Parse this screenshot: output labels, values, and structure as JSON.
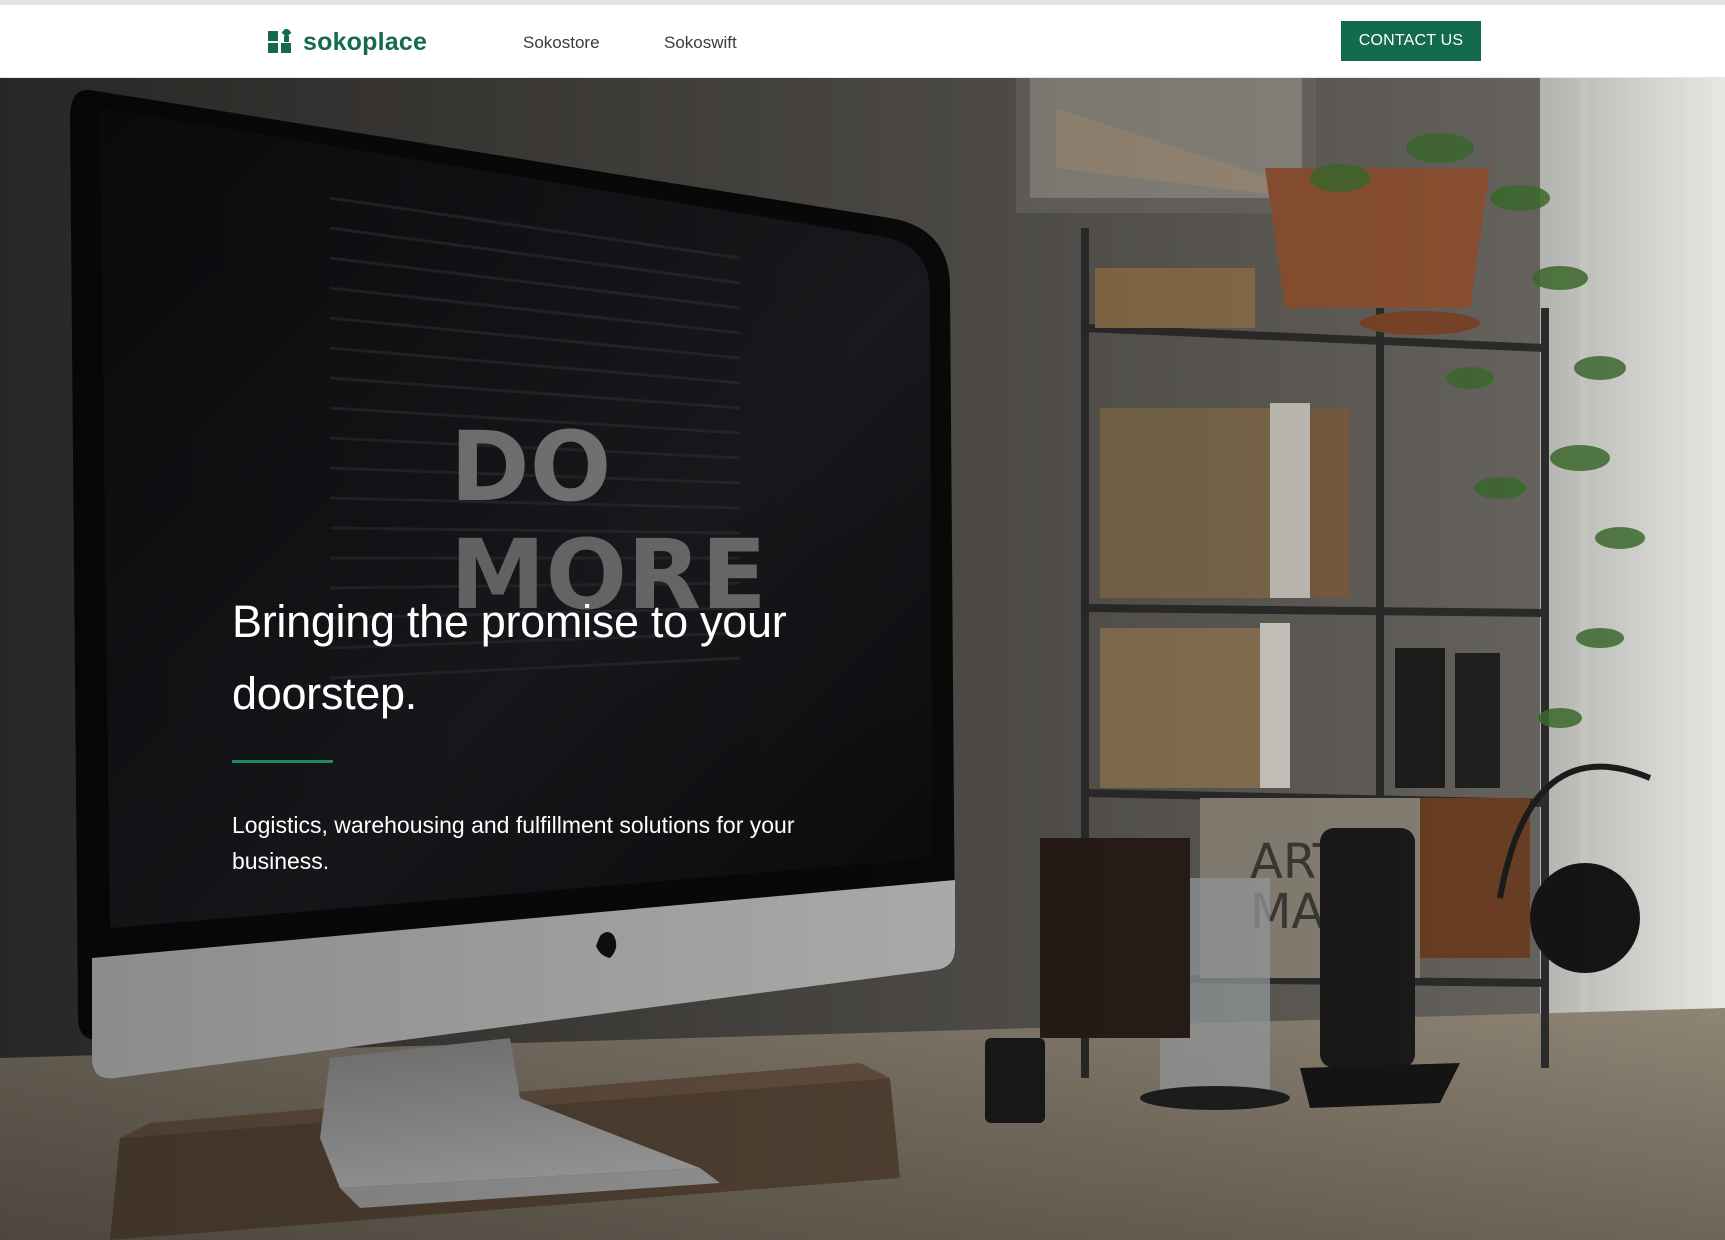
{
  "brand": {
    "name": "sokoplace",
    "color": "#136b4c"
  },
  "nav": {
    "links": [
      "Sokostore",
      "Sokoswift"
    ],
    "cta_label": "CONTACT US"
  },
  "hero": {
    "title": "Bringing the promise to your doorstep.",
    "subtitle": "Logistics, warehousing and fulfillment solutions for your business.",
    "accent_color": "#1f8a5f",
    "background": "Desk workspace photo with iMac, shelf, plant and headphones",
    "screen_text": [
      "DO",
      "MORE"
    ],
    "signage_text": [
      "ART",
      "MA"
    ]
  }
}
